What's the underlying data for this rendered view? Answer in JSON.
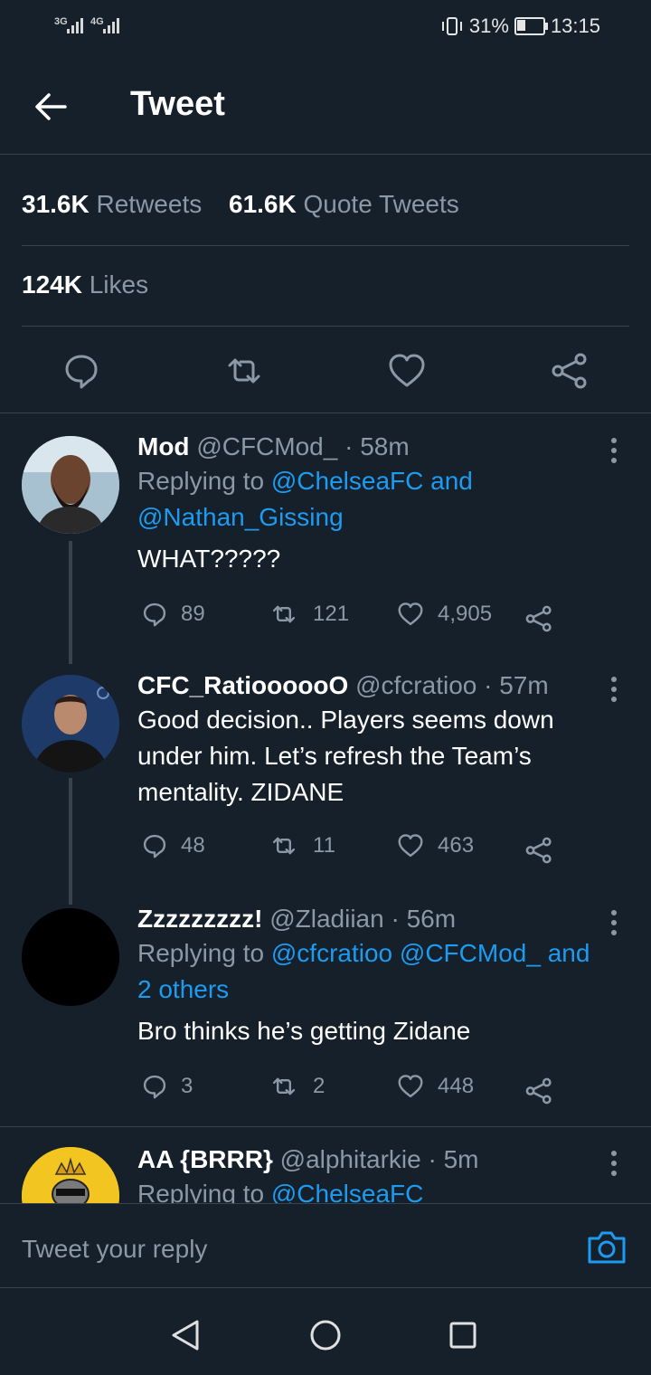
{
  "status_bar": {
    "signal1": "3G",
    "signal2": "4G",
    "battery_percent": "31%",
    "battery_level": 0.31,
    "time": "13:15"
  },
  "header": {
    "title": "Tweet"
  },
  "stats": {
    "retweets_count": "31.6K",
    "retweets_label": "Retweets",
    "quotes_count": "61.6K",
    "quotes_label": "Quote Tweets",
    "likes_count": "124K",
    "likes_label": "Likes"
  },
  "icons": {
    "back": "arrow-left-icon",
    "reply": "speech-bubble-icon",
    "retweet": "retweet-icon",
    "like": "heart-icon",
    "share": "share-icon",
    "more": "more-vertical-icon",
    "camera": "camera-icon"
  },
  "colors": {
    "background": "#15202b",
    "accent": "#1d9bf0",
    "muted": "#8b98a5",
    "divider": "#38444d"
  },
  "replies": [
    {
      "name": "Mod",
      "handle": "@CFCMod_",
      "time": "· 58m",
      "replying_prefix": "Replying to",
      "replying_line1": "@ChelseaFC and",
      "replying_line2": "@Nathan_Gissing",
      "text": "WHAT?????",
      "reply_count": "89",
      "retweet_count": "121",
      "like_count": "4,905"
    },
    {
      "name": "CFC_RatioooooO",
      "handle": "@cfcratioo",
      "time": "· 57m",
      "text_line1": "Good decision.. Players seems down",
      "text_line2": "under him. Let’s refresh the Team’s",
      "text_line3": "mentality. ZIDANE",
      "reply_count": "48",
      "retweet_count": "11",
      "like_count": "463"
    },
    {
      "name": "Zzzzzzzzz!",
      "handle": "@Zladiian",
      "time": "· 56m",
      "replying_prefix": "Replying to",
      "replying_line1": "@cfcratioo @CFCMod_ and",
      "replying_line2": "2 others",
      "text": "Bro thinks he’s getting Zidane",
      "reply_count": "3",
      "retweet_count": "2",
      "like_count": "448"
    },
    {
      "name": "AA {BRRR}",
      "handle": "@alphitarkie",
      "time": "· 5m",
      "replying_prefix": "Replying to",
      "replying_line1": "@ChelseaFC"
    }
  ],
  "compose": {
    "placeholder": "Tweet your reply"
  },
  "navbar": {
    "back": "triangle-back-icon",
    "home": "circle-home-icon",
    "recents": "square-recents-icon"
  }
}
